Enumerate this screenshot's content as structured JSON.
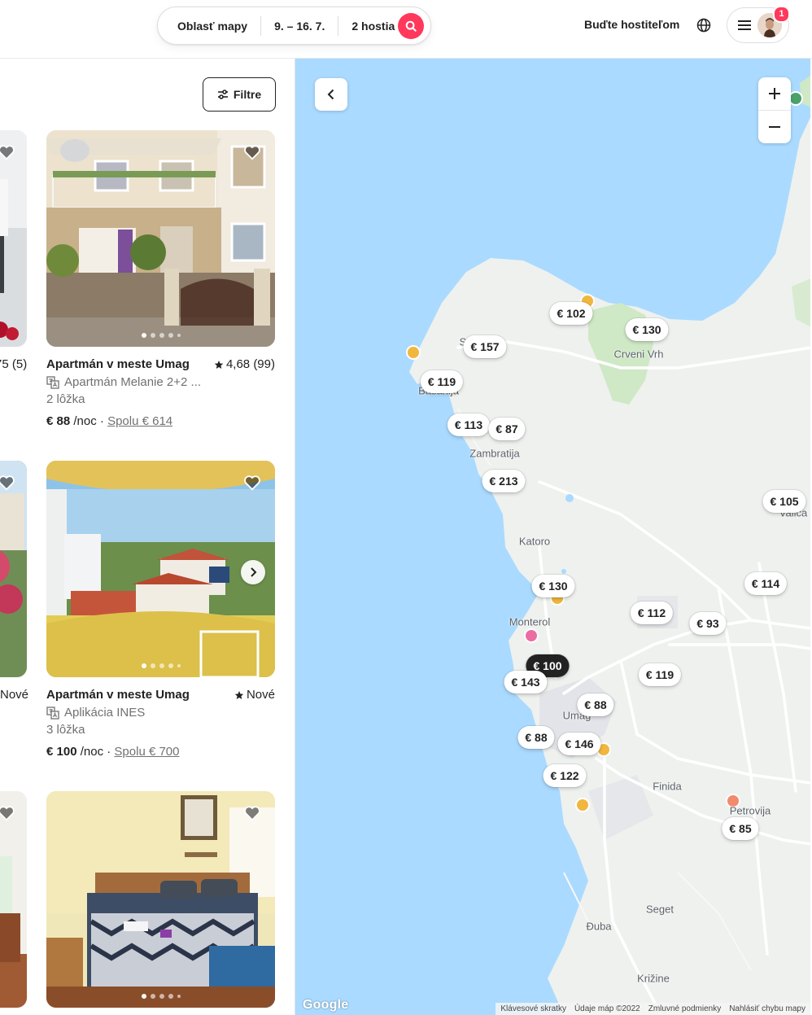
{
  "header": {
    "search": {
      "location": "Oblasť mapy",
      "dates": "9. – 16. 7.",
      "guests": "2 hostia",
      "button_icon": "search-icon"
    },
    "host_link": "Buďte hostiteľom",
    "globe_icon": "globe-icon",
    "menu_icon": "hamburger-icon",
    "notification_count": "1"
  },
  "listings": {
    "filters_label": "Filtre",
    "left_partial": [
      "75 (5)",
      "Nové"
    ],
    "cards": [
      {
        "title": "Apartmán v meste Umag",
        "rating": "4,68 (99)",
        "subtitle": "Apartmán Melanie 2+2 ...",
        "beds": "2 lôžka",
        "price": "€ 88",
        "per_night": "/noc",
        "separator": "·",
        "total": "Spolu € 614"
      },
      {
        "title": "Apartmán v meste Umag",
        "rating": "Nové",
        "subtitle": "Aplikácia INES",
        "beds": "3 lôžka",
        "price": "€ 100",
        "per_night": "/noc",
        "separator": "·",
        "total": "Spolu € 700"
      }
    ]
  },
  "map": {
    "prices": [
      "€ 102",
      "€ 130",
      "€ 157",
      "€ 119",
      "€ 113",
      "€ 87",
      "€ 213",
      "€ 105",
      "€ 130",
      "€ 114",
      "€ 112",
      "€ 93",
      "€ 100",
      "€ 143",
      "€ 119",
      "€ 88",
      "€ 88",
      "€ 146",
      "€ 122",
      "€ 85"
    ],
    "active_price": "€ 100",
    "places": [
      "Crveni Vrh",
      "Zambratija",
      "Katoro",
      "Monterol",
      "Umag",
      "Finida",
      "Petrovija",
      "Seget",
      "Đuba",
      "Križine",
      "Valica",
      "Basanija",
      "S"
    ],
    "zoom_in": "+",
    "zoom_out": "−",
    "google_logo": "Google",
    "attribution": [
      "Klávesové skratky",
      "Údaje máp ©2022",
      "Zmluvné podmienky",
      "Nahlásiť chybu mapy"
    ]
  },
  "colors": {
    "brand": "#ff385c",
    "water": "#aadaff",
    "land": "#eef2ee",
    "text": "#222222",
    "muted": "#717171"
  }
}
